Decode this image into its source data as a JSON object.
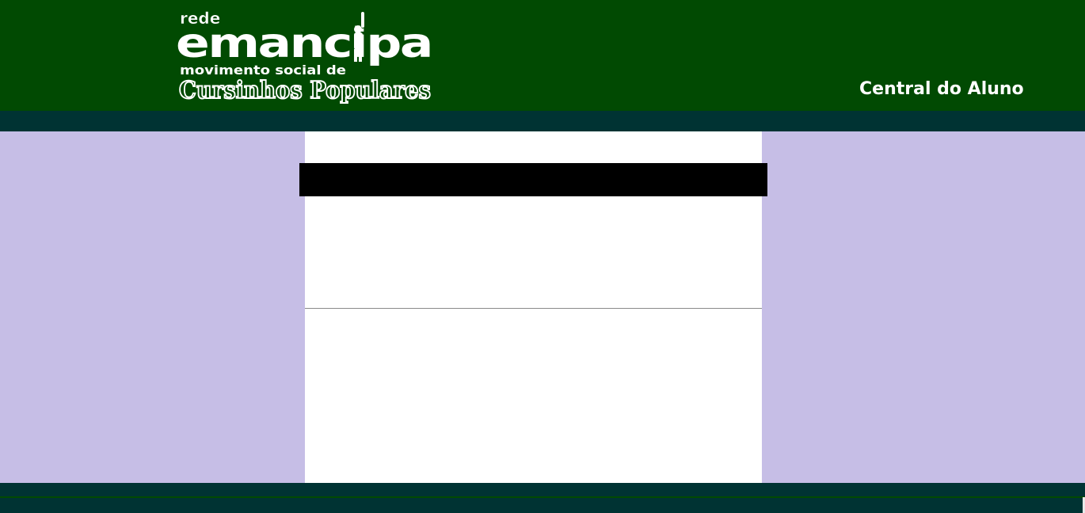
{
  "header": {
    "logo": {
      "line1": "rede",
      "line2": "emancipa",
      "line3": "movimento social de",
      "line4": "Cursinhos Populares"
    },
    "title": "Central do Aluno"
  },
  "colors": {
    "header_bg": "#014a02",
    "band_bg": "#003333",
    "side_bg": "#c6bee6",
    "main_bg": "#ffffff",
    "bar_bg": "#000000"
  }
}
